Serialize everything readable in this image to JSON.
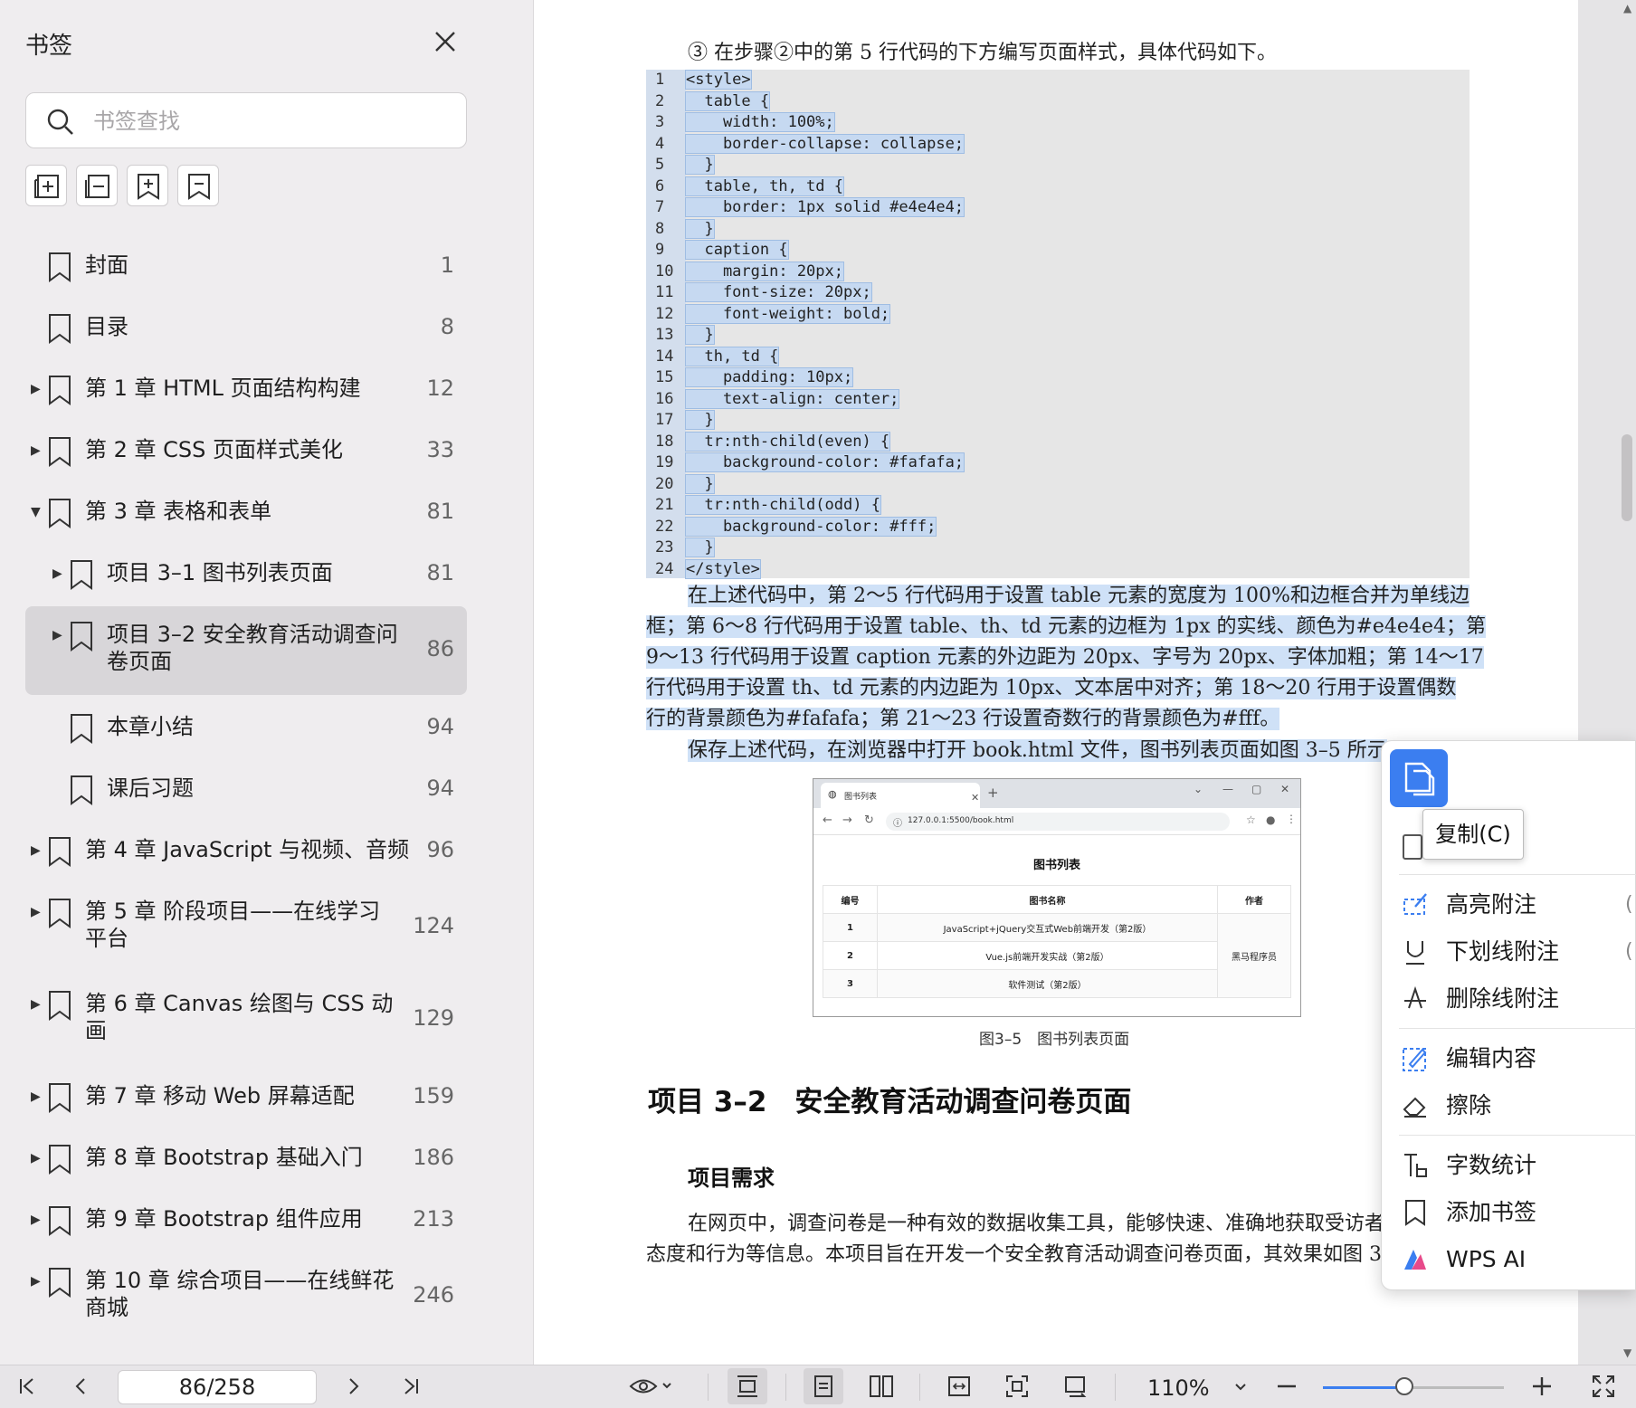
{
  "sidebar": {
    "title": "书签",
    "search_placeholder": "书签查找",
    "items": [
      {
        "label": "封面",
        "page": "1",
        "label2": ""
      },
      {
        "label": "目录",
        "page": "8",
        "label2": ""
      },
      {
        "label": "第 1 章 HTML 页面结构构建",
        "page": "12",
        "label2": ""
      },
      {
        "label": "第 2 章 CSS 页面样式美化",
        "page": "33",
        "label2": ""
      },
      {
        "label": "第 3 章 表格和表单",
        "page": "81",
        "label2": ""
      },
      {
        "label": "项目 3–1 图书列表页面",
        "page": "81",
        "label2": ""
      },
      {
        "label": "项目 3–2 安全教育活动调查问",
        "page": "86",
        "label2": "卷页面"
      },
      {
        "label": "本章小结",
        "page": "94",
        "label2": ""
      },
      {
        "label": "课后习题",
        "page": "94",
        "label2": ""
      },
      {
        "label": "第 4 章 JavaScript 与视频、音频",
        "page": "96",
        "label2": ""
      },
      {
        "label": "第 5 章 阶段项目——在线学习",
        "page": "124",
        "label2": "平台"
      },
      {
        "label": "第 6 章 Canvas 绘图与 CSS 动",
        "page": "129",
        "label2": "画"
      },
      {
        "label": "第 7 章 移动 Web 屏幕适配",
        "page": "159",
        "label2": ""
      },
      {
        "label": "第 8 章 Bootstrap 基础入门",
        "page": "186",
        "label2": ""
      },
      {
        "label": "第 9 章 Bootstrap 组件应用",
        "page": "213",
        "label2": ""
      },
      {
        "label": "第 10 章 综合项目——在线鲜花",
        "page": "246",
        "label2": "商城"
      }
    ]
  },
  "doc": {
    "intro": "③ 在步骤②中的第 5 行代码的下方编写页面样式，具体代码如下。",
    "code": [
      {
        "n": "1",
        "t": "<style>"
      },
      {
        "n": "2",
        "t": "  table {"
      },
      {
        "n": "3",
        "t": "    width: 100%;"
      },
      {
        "n": "4",
        "t": "    border-collapse: collapse;"
      },
      {
        "n": "5",
        "t": "  }"
      },
      {
        "n": "6",
        "t": "  table, th, td {"
      },
      {
        "n": "7",
        "t": "    border: 1px solid #e4e4e4;"
      },
      {
        "n": "8",
        "t": "  }"
      },
      {
        "n": "9",
        "t": "  caption {"
      },
      {
        "n": "10",
        "t": "    margin: 20px;"
      },
      {
        "n": "11",
        "t": "    font-size: 20px;"
      },
      {
        "n": "12",
        "t": "    font-weight: bold;"
      },
      {
        "n": "13",
        "t": "  }"
      },
      {
        "n": "14",
        "t": "  th, td {"
      },
      {
        "n": "15",
        "t": "    padding: 10px;"
      },
      {
        "n": "16",
        "t": "    text-align: center;"
      },
      {
        "n": "17",
        "t": "  }"
      },
      {
        "n": "18",
        "t": "  tr:nth-child(even) {"
      },
      {
        "n": "19",
        "t": "    background-color: #fafafa;"
      },
      {
        "n": "20",
        "t": "  }"
      },
      {
        "n": "21",
        "t": "  tr:nth-child(odd) {"
      },
      {
        "n": "22",
        "t": "    background-color: #fff;"
      },
      {
        "n": "23",
        "t": "  }"
      },
      {
        "n": "24",
        "t": "</style>"
      }
    ],
    "explain": [
      "在上述代码中，第 2～5 行代码用于设置 table 元素的宽度为 100%和边框合并为单线边",
      "框；第 6～8 行代码用于设置 table、th、td 元素的边框为 1px 的实线、颜色为#e4e4e4；第",
      "9～13 行代码用于设置 caption 元素的外边距为 20px、字号为 20px、字体加粗；第 14～17",
      "行代码用于设置 th、td 元素的内边距为 10px、文本居中对齐；第 18～20 行用于设置偶数",
      "行的背景颜色为#fafafa；第 21～23 行设置奇数行的背景颜色为#fff。"
    ],
    "save_line": "保存上述代码，在浏览器中打开 book.html 文件，图书列表页面如图 3–5 所示",
    "figure": {
      "tab_title": "图书列表",
      "url": "127.0.0.1:5500/book.html",
      "table_title": "图书列表",
      "headers": [
        "编号",
        "图书名称",
        "作者"
      ],
      "rows": [
        {
          "no": "1",
          "name": "JavaScript+jQuery交互式Web前端开发（第2版）"
        },
        {
          "no": "2",
          "name": "Vue.js前端开发实战（第2版）"
        },
        {
          "no": "3",
          "name": "软件测试（第2版）"
        }
      ],
      "author": "黑马程序员",
      "caption": "图3–5　图书列表页面"
    },
    "h2": "项目 3–2　安全教育活动调查问卷页面",
    "h3": "项目需求",
    "body": [
      "在网页中，调查问卷是一种有效的数据收集工具，能够快速、准确地获取受访者",
      "态度和行为等信息。本项目旨在开发一个安全教育活动调查问卷页面，其效果如图 3"
    ]
  },
  "context_menu": {
    "tooltip": "复制(C)",
    "items": [
      {
        "label": "高亮附注",
        "icon": "highlight-icon",
        "key": "("
      },
      {
        "label": "下划线附注",
        "icon": "underline-icon",
        "key": "("
      },
      {
        "label": "删除线附注",
        "icon": "strikethrough-icon",
        "key": ""
      },
      {
        "label": "编辑内容",
        "icon": "edit-icon",
        "key": ""
      },
      {
        "label": "擦除",
        "icon": "eraser-icon",
        "key": ""
      },
      {
        "label": "字数统计",
        "icon": "word-count-icon",
        "key": ""
      },
      {
        "label": "添加书签",
        "icon": "bookmark-icon",
        "key": ""
      },
      {
        "label": "WPS AI",
        "icon": "wps-ai-icon",
        "key": ""
      }
    ]
  },
  "bottom": {
    "page_indicator": "86/258",
    "zoom": "110%",
    "zoom_fraction": 0.45
  },
  "colors": {
    "accent": "#3b7ef0",
    "selection": "#c6d9f1"
  }
}
